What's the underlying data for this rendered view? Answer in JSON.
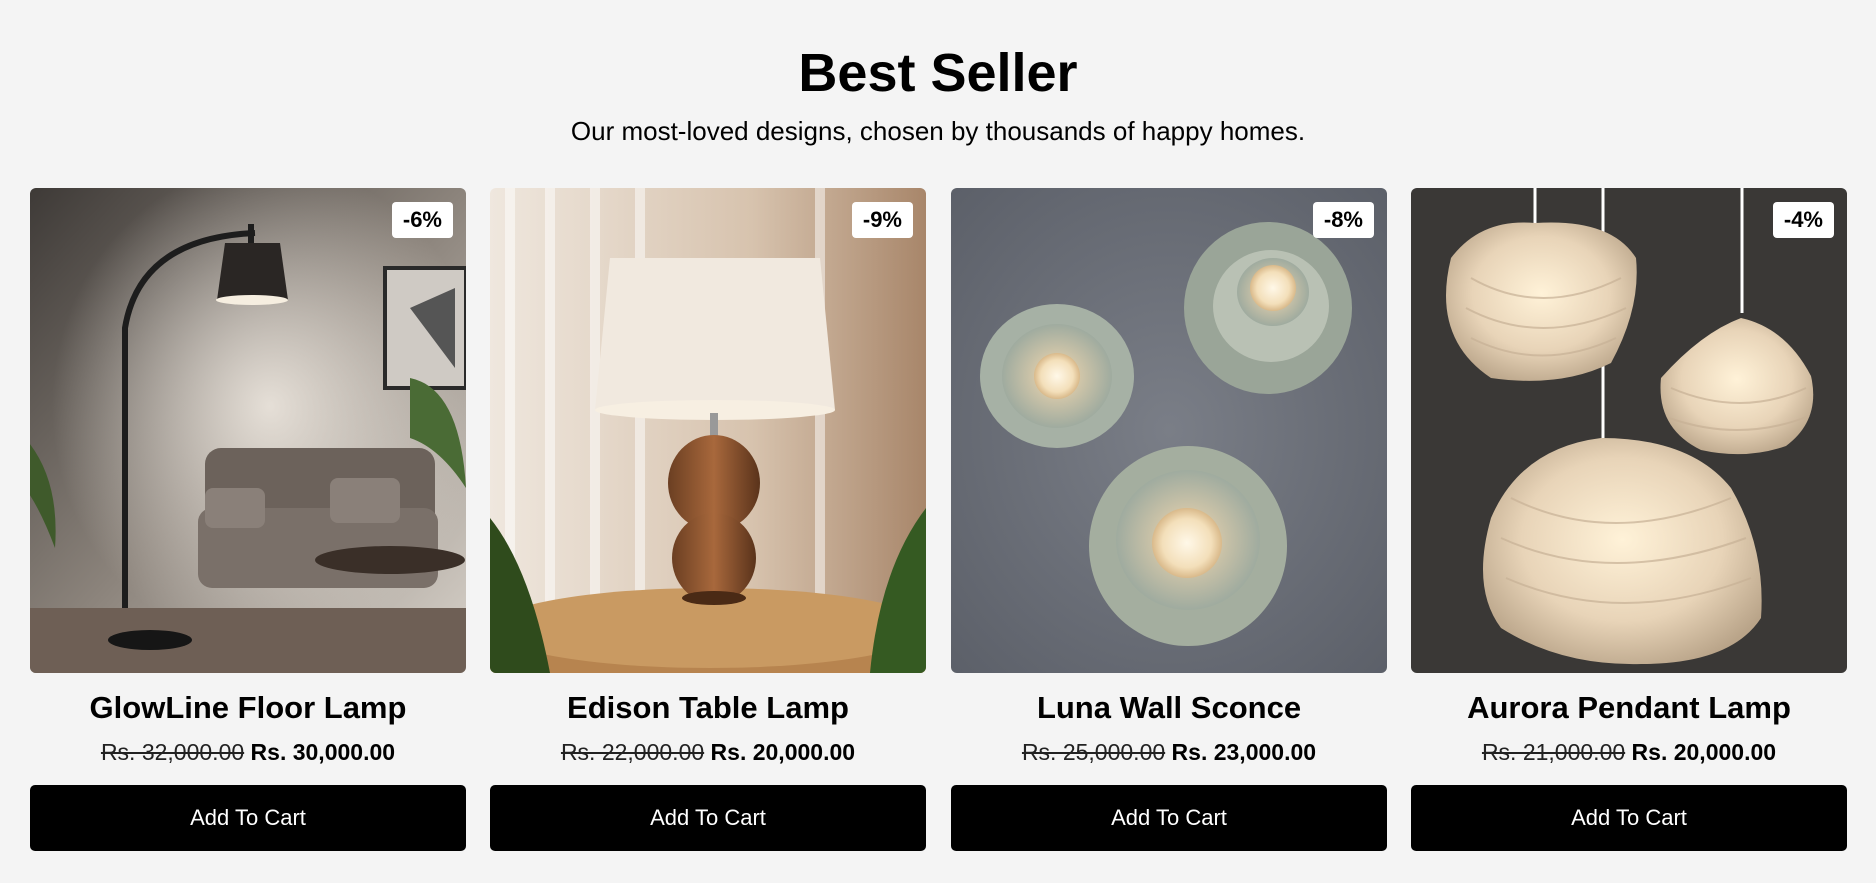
{
  "section": {
    "title": "Best Seller",
    "subtitle": "Our most-loved designs, chosen by thousands of happy homes."
  },
  "products": [
    {
      "name": "GlowLine Floor Lamp",
      "discount": "-6%",
      "old_price": "Rs. 32,000.00",
      "new_price": "Rs. 30,000.00",
      "cta": "Add To Cart"
    },
    {
      "name": "Edison Table Lamp",
      "discount": "-9%",
      "old_price": "Rs. 22,000.00",
      "new_price": "Rs. 20,000.00",
      "cta": "Add To Cart"
    },
    {
      "name": "Luna Wall Sconce",
      "discount": "-8%",
      "old_price": "Rs. 25,000.00",
      "new_price": "Rs. 23,000.00",
      "cta": "Add To Cart"
    },
    {
      "name": "Aurora Pendant Lamp",
      "discount": "-4%",
      "old_price": "Rs. 21,000.00",
      "new_price": "Rs. 20,000.00",
      "cta": "Add To Cart"
    }
  ],
  "colors": {
    "page_background": "#f4f4f4",
    "button_background": "#000000",
    "button_text": "#ffffff",
    "badge_background": "#ffffff"
  }
}
